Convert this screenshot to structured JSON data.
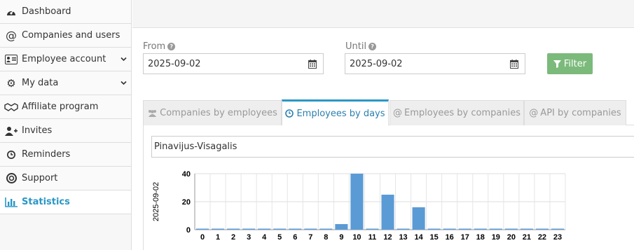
{
  "sidebar": {
    "items": [
      {
        "label": "Dashboard",
        "icon": "dashboard-icon",
        "glyph": "◕"
      },
      {
        "label": "Companies and users",
        "icon": "at-icon",
        "glyph": "@"
      },
      {
        "label": "Employee account",
        "icon": "id-card-icon",
        "glyph": "▤",
        "chevron": "⌄"
      },
      {
        "label": "My data",
        "icon": "cogs-icon",
        "glyph": "⚙",
        "chevron": "⌄"
      },
      {
        "label": "Affiliate program",
        "icon": "handshake-icon",
        "glyph": "⚭"
      },
      {
        "label": "Invites",
        "icon": "user-plus-icon",
        "glyph": "👤"
      },
      {
        "label": "Reminders",
        "icon": "clock-icon",
        "glyph": "◷"
      },
      {
        "label": "Support",
        "icon": "life-ring-icon",
        "glyph": "◎"
      },
      {
        "label": "Statistics",
        "icon": "bar-chart-icon",
        "glyph": "▮",
        "active": true
      }
    ]
  },
  "form": {
    "from_label": "From",
    "from_value": "2025-09-02",
    "until_label": "Until",
    "until_value": "2025-09-02",
    "filter_label": "Filter",
    "help_glyph": "?"
  },
  "tabs": [
    {
      "label": "Companies by employees",
      "icon": "users-icon",
      "glyph": "👥"
    },
    {
      "label": "Employees by days",
      "icon": "clock-icon",
      "glyph": "◷",
      "active": true
    },
    {
      "label": "Employees by companies",
      "icon": "at-icon",
      "glyph": "@"
    },
    {
      "label": "API by companies",
      "icon": "at-icon",
      "glyph": "@"
    }
  ],
  "company_select": "Pinavijus-Visagalis",
  "colors": {
    "accent": "#2a97c6",
    "bar": "#5b9bd5",
    "filter": "#7bba7b"
  },
  "chart_data": {
    "type": "bar",
    "ylabel": "2025-09-02",
    "categories": [
      "0",
      "1",
      "2",
      "3",
      "4",
      "5",
      "6",
      "7",
      "8",
      "9",
      "10",
      "11",
      "12",
      "13",
      "14",
      "15",
      "16",
      "17",
      "18",
      "19",
      "20",
      "21",
      "22",
      "23"
    ],
    "values": [
      0,
      0,
      0,
      0,
      0,
      0,
      0,
      0,
      0,
      4,
      40,
      0,
      25,
      0,
      16,
      0,
      0,
      0,
      0,
      0,
      0,
      0,
      0,
      0
    ],
    "yticks": [
      0,
      20,
      40
    ],
    "ylim": [
      0,
      40
    ],
    "grid": true
  }
}
